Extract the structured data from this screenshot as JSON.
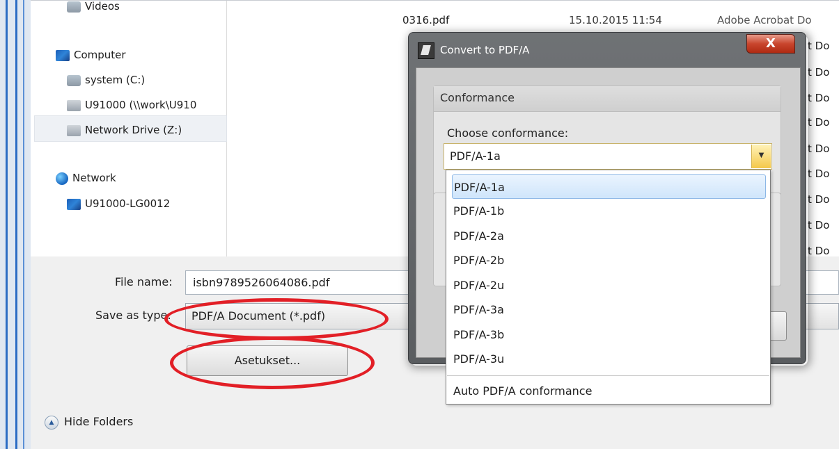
{
  "nav": {
    "videos": "Videos",
    "computer": "Computer",
    "system_drive": "system (C:)",
    "network_share": "U91000 (\\\\work\\U910",
    "network_drive": "Network Drive (Z:)",
    "network": "Network",
    "network_pc": "U91000-LG0012"
  },
  "file_list": {
    "first_name": "0316.pdf",
    "first_date": "15.10.2015 11:54",
    "type_labels": [
      "Adobe Acrobat Do",
      "t Do",
      "t Do",
      "t Do",
      "t Do",
      "t Do",
      "t Do",
      "t Do",
      "t Do",
      "t Do"
    ]
  },
  "save_form": {
    "file_name_label": "File name:",
    "file_name_value": "isbn9789526064086.pdf",
    "save_type_label": "Save as type:",
    "save_type_value": "PDF/A Document (*.pdf)",
    "settings_button": "Asetukset...",
    "hide_folders": "Hide Folders"
  },
  "dialog": {
    "title": "Convert to PDF/A",
    "close_glyph": "X",
    "group_title": "Conformance",
    "choose_label": "Choose conformance:",
    "selected": "PDF/A-1a",
    "options": [
      "PDF/A-1a",
      "PDF/A-1b",
      "PDF/A-2a",
      "PDF/A-2b",
      "PDF/A-2u",
      "PDF/A-3a",
      "PDF/A-3b",
      "PDF/A-3u"
    ],
    "auto_option": "Auto PDF/A conformance"
  },
  "colors": {
    "highlight_red": "#e21f26",
    "dialog_frame": "#5f6265",
    "selection_blue": "#cfe5fb"
  }
}
